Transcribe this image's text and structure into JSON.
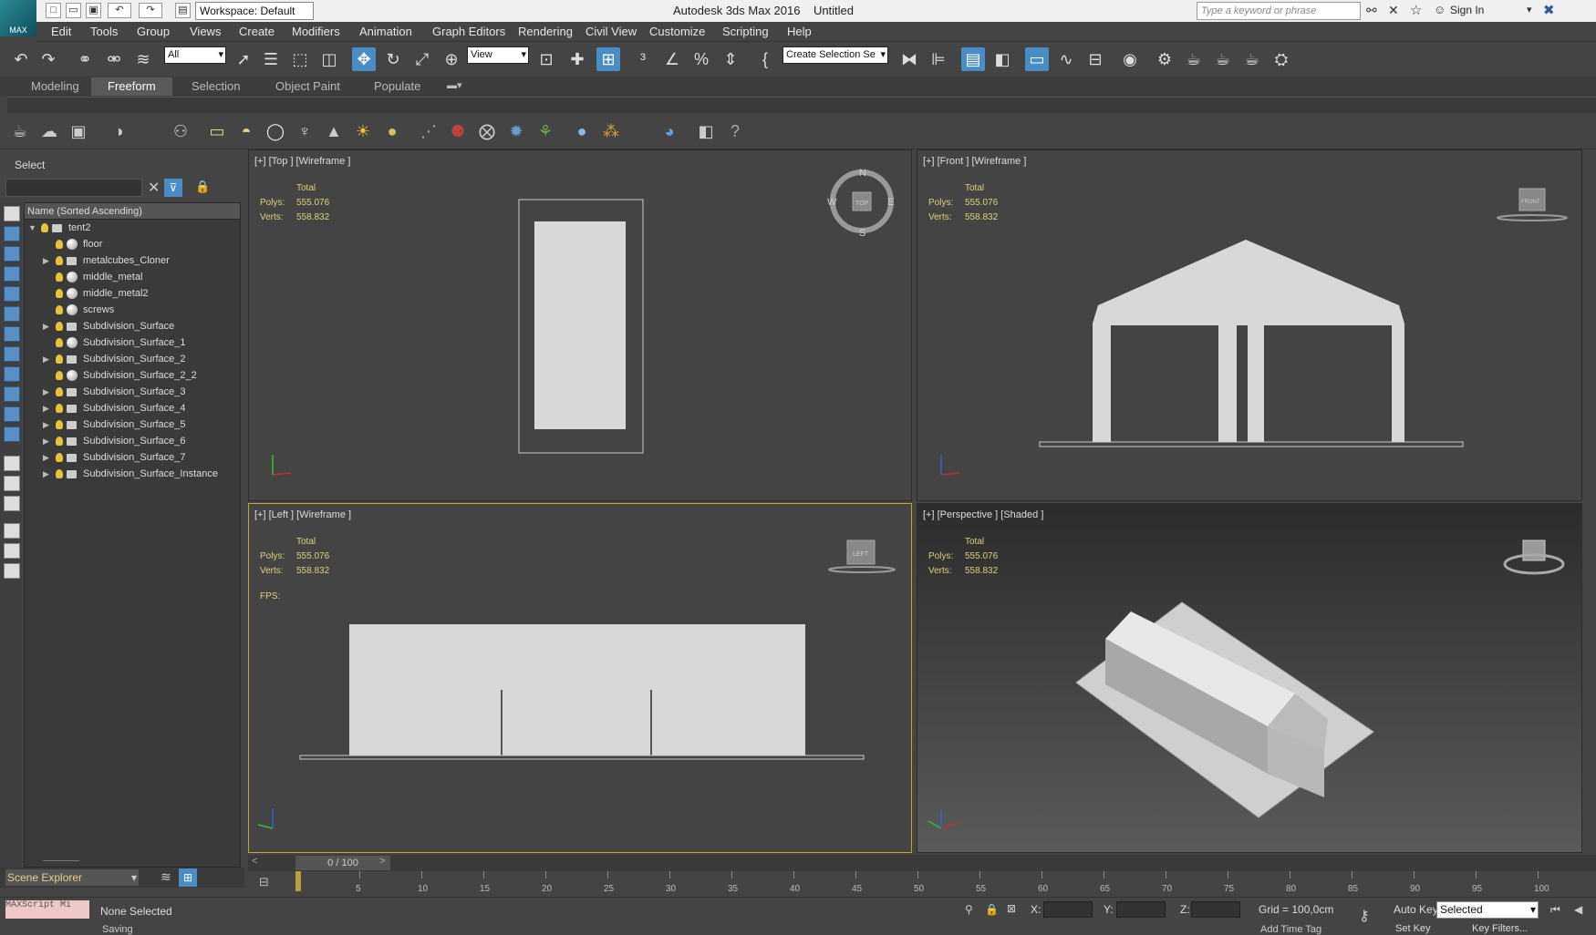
{
  "titlebar": {
    "workspace": "Workspace: Default",
    "app_title": "Autodesk 3ds Max 2016",
    "doc_title": "Untitled",
    "search_placeholder": "Type a keyword or phrase",
    "sign_in": "Sign In",
    "logo_text": "MAX"
  },
  "menu": [
    "Edit",
    "Tools",
    "Group",
    "Views",
    "Create",
    "Modifiers",
    "Animation",
    "Graph Editors",
    "Rendering",
    "Civil View",
    "Customize",
    "Scripting",
    "Help"
  ],
  "toolbar": {
    "filter": "All",
    "view": "View",
    "selection_set": "Create Selection Se"
  },
  "ribbon_tabs": [
    "Modeling",
    "Freeform",
    "Selection",
    "Object Paint",
    "Populate"
  ],
  "ribbon_active": "Freeform",
  "explorer": {
    "title": "Select",
    "column": "Name (Sorted Ascending)",
    "footer": "Scene Explorer",
    "items": [
      {
        "name": "tent2",
        "expand": "▼",
        "level": 0,
        "kind": "grp"
      },
      {
        "name": "floor",
        "expand": "",
        "level": 1,
        "kind": "sphere"
      },
      {
        "name": "metalcubes_Cloner",
        "expand": "▶",
        "level": 1,
        "kind": "grp"
      },
      {
        "name": "middle_metal",
        "expand": "",
        "level": 1,
        "kind": "sphere"
      },
      {
        "name": "middle_metal2",
        "expand": "",
        "level": 1,
        "kind": "sphere"
      },
      {
        "name": "screws",
        "expand": "",
        "level": 1,
        "kind": "sphere"
      },
      {
        "name": "Subdivision_Surface",
        "expand": "▶",
        "level": 1,
        "kind": "grp"
      },
      {
        "name": "Subdivision_Surface_1",
        "expand": "",
        "level": 1,
        "kind": "sphere"
      },
      {
        "name": "Subdivision_Surface_2",
        "expand": "▶",
        "level": 1,
        "kind": "grp"
      },
      {
        "name": "Subdivision_Surface_2_2",
        "expand": "",
        "level": 1,
        "kind": "sphere"
      },
      {
        "name": "Subdivision_Surface_3",
        "expand": "▶",
        "level": 1,
        "kind": "grp"
      },
      {
        "name": "Subdivision_Surface_4",
        "expand": "▶",
        "level": 1,
        "kind": "grp"
      },
      {
        "name": "Subdivision_Surface_5",
        "expand": "▶",
        "level": 1,
        "kind": "grp"
      },
      {
        "name": "Subdivision_Surface_6",
        "expand": "▶",
        "level": 1,
        "kind": "grp"
      },
      {
        "name": "Subdivision_Surface_7",
        "expand": "▶",
        "level": 1,
        "kind": "grp"
      },
      {
        "name": "Subdivision_Surface_Instance",
        "expand": "▶",
        "level": 1,
        "kind": "grp"
      }
    ]
  },
  "viewports": {
    "top": {
      "label": "[+] [Top ] [Wireframe ]",
      "cube": "TOP"
    },
    "front": {
      "label": "[+] [Front ] [Wireframe ]",
      "cube": "FRONT"
    },
    "left": {
      "label": "[+] [Left ] [Wireframe ]",
      "cube": "LEFT"
    },
    "persp": {
      "label": "[+] [Perspective ] [Shaded ]"
    },
    "stats": {
      "total": "Total",
      "polys_label": "Polys:",
      "polys": "555.076",
      "verts_label": "Verts:",
      "verts": "558.832",
      "fps_label": "FPS:"
    },
    "compass": {
      "n": "N",
      "s": "S",
      "e": "E",
      "w": "W"
    }
  },
  "timeline": {
    "position": "0 / 100",
    "ticks": [
      "5",
      "10",
      "15",
      "20",
      "25",
      "30",
      "35",
      "40",
      "45",
      "50",
      "55",
      "60",
      "65",
      "70",
      "75",
      "80",
      "85",
      "90",
      "95",
      "100"
    ]
  },
  "status": {
    "maxscript": "MAXScript Mi",
    "selection": "None Selected",
    "saving": "Saving",
    "x_label": "X:",
    "y_label": "Y:",
    "z_label": "Z:",
    "grid": "Grid = 100,0cm",
    "auto_key": "Auto Key",
    "selected": "Selected",
    "set_key": "Set Key",
    "key_filters": "Key Filters...",
    "add_time_tag": "Add Time Tag"
  }
}
